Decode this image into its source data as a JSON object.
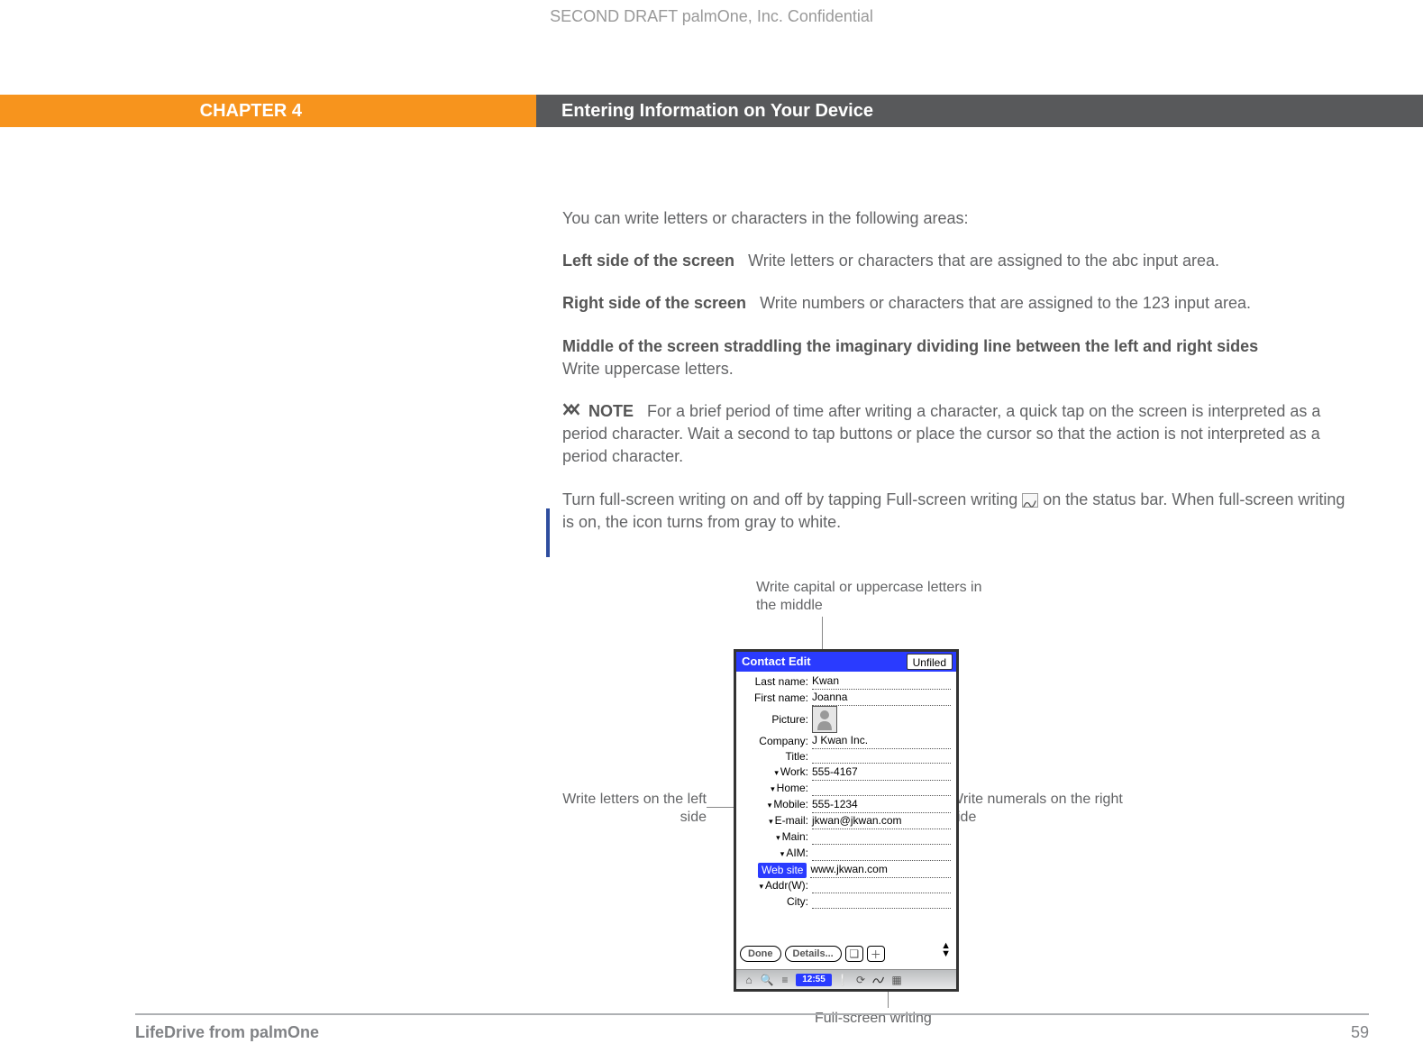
{
  "header": {
    "confidential": "SECOND DRAFT palmOne, Inc.  Confidential",
    "chapter": "CHAPTER 4",
    "title": "Entering Information on Your Device"
  },
  "body": {
    "intro": "You can write letters or characters in the following areas:",
    "left_label": "Left side of the screen",
    "left_text": "Write letters or characters that are assigned to the abc input area.",
    "right_label": "Right side of the screen",
    "right_text": "Write numbers or characters that are assigned to the 123 input area.",
    "middle_label": "Middle of the screen straddling the imaginary dividing line between the left and right sides",
    "middle_text": "Write uppercase letters.",
    "note_label": "NOTE",
    "note_text": "For a brief period of time after writing a character, a quick tap on the screen is interpreted as a period character. Wait a second to tap buttons or place the cursor so that the action is not interpreted as a period character.",
    "fs_pre": "Turn full-screen writing on and off by tapping Full-screen writing ",
    "fs_post": " on the status bar. When full-screen writing is on, the icon turns from gray to white."
  },
  "callouts": {
    "top": "Write capital or uppercase letters in the middle",
    "left": "Write letters on the left side",
    "right": "Write numerals on the right side",
    "bottom": "Full-screen writing"
  },
  "device": {
    "title": "Contact Edit",
    "category": "Unfiled",
    "fields": {
      "last_name_l": "Last name:",
      "last_name_v": "Kwan",
      "first_name_l": "First name:",
      "first_name_v": "Joanna",
      "picture_l": "Picture:",
      "company_l": "Company:",
      "company_v": "J Kwan Inc.",
      "title_l": "Title:",
      "title_v": "",
      "work_l": "Work:",
      "work_v": "555-4167",
      "home_l": "Home:",
      "home_v": "",
      "mobile_l": "Mobile:",
      "mobile_v": "555-1234",
      "email_l": "E-mail:",
      "email_v": "jkwan@jkwan.com",
      "main_l": "Main:",
      "main_v": "",
      "aim_l": "AIM:",
      "aim_v": "",
      "website_l": "Web site",
      "website_v": "www.jkwan.com",
      "addr_l": "Addr(W):",
      "addr_v": "",
      "city_l": "City:",
      "city_v": ""
    },
    "buttons": {
      "done": "Done",
      "details": "Details..."
    },
    "status": {
      "clock": "12:55"
    }
  },
  "footer": {
    "left": "LifeDrive from palmOne",
    "page": "59"
  }
}
